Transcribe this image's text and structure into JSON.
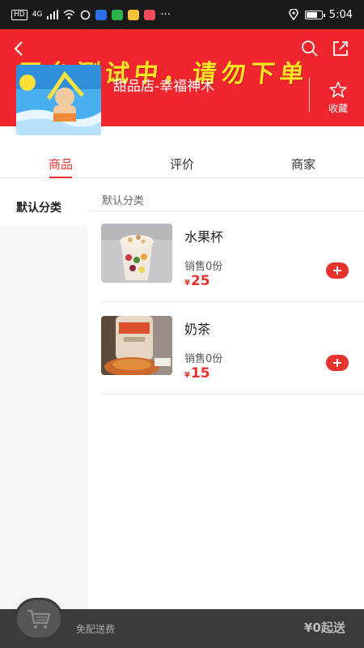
{
  "status_bar": {
    "network_tag": "HD",
    "signal_label": "4G",
    "time": "5:04",
    "battery_level": 0.8,
    "more": "···"
  },
  "header": {
    "banner_text": "平台测试中，请勿下单",
    "store_name": "甜品店-幸福神木",
    "favorite_label": "收藏"
  },
  "tabs": [
    {
      "label": "商品",
      "active": true
    },
    {
      "label": "评价",
      "active": false
    },
    {
      "label": "商家",
      "active": false
    }
  ],
  "categories": [
    {
      "label": "默认分类",
      "active": true
    }
  ],
  "section_title": "默认分类",
  "products": [
    {
      "name": "水果杯",
      "sales": "销售0份",
      "currency": "¥",
      "price": "25"
    },
    {
      "name": "奶茶",
      "sales": "销售0份",
      "currency": "¥",
      "price": "15"
    }
  ],
  "cart": {
    "delivery": "免配送费",
    "min_order": "¥0起送"
  },
  "colors": {
    "header_red": "#f0262e",
    "accent_red": "#e5322d",
    "banner_yellow": "#fde427",
    "cart_bar": "#3b3b3b"
  },
  "icons": [
    "back-icon",
    "search-icon",
    "share-icon",
    "star-icon",
    "plus-icon",
    "cart-icon"
  ]
}
